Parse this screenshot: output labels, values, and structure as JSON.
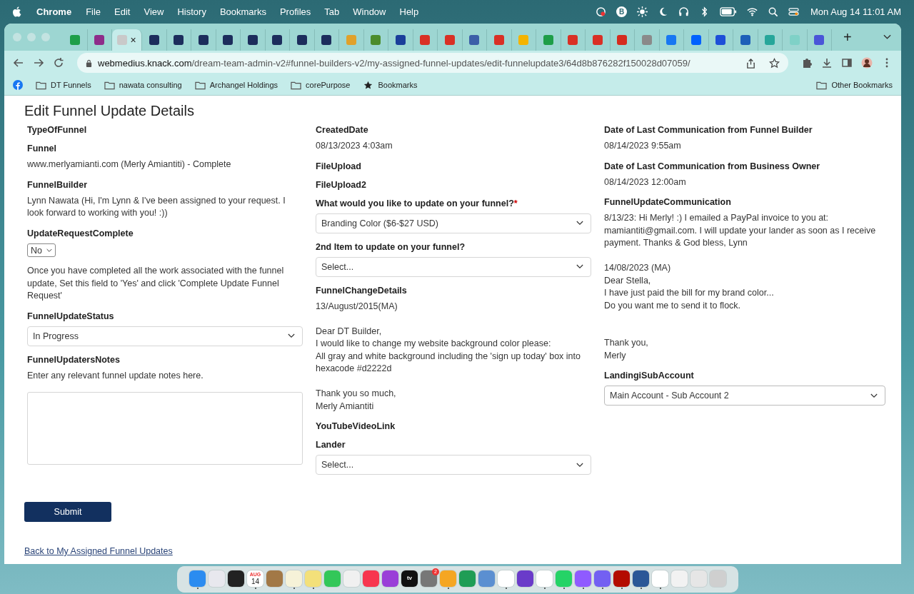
{
  "menu_bar": {
    "app": "Chrome",
    "menus": [
      "File",
      "Edit",
      "View",
      "History",
      "Bookmarks",
      "Profiles",
      "Tab",
      "Window",
      "Help"
    ],
    "status_icons": [
      "B"
    ],
    "clock": "Mon Aug 14  11:01 AM"
  },
  "tabs": [
    {
      "color": "#1e9e48",
      "selected": false
    },
    {
      "color": "#8e2c8a",
      "selected": false
    },
    {
      "color": "#c9c9c9",
      "selected": true,
      "close": "×"
    },
    {
      "color": "#1c2d5c",
      "selected": false
    },
    {
      "color": "#1c2d5c",
      "selected": false
    },
    {
      "color": "#1c2d5c",
      "selected": false
    },
    {
      "color": "#1c2d5c",
      "selected": false
    },
    {
      "color": "#1c2d5c",
      "selected": false
    },
    {
      "color": "#1c2d5c",
      "selected": false
    },
    {
      "color": "#1c2d5c",
      "selected": false
    },
    {
      "color": "#1c2d5c",
      "selected": false
    },
    {
      "color": "#e0a12b",
      "selected": false
    },
    {
      "color": "#4c8c2c",
      "selected": false
    },
    {
      "color": "#1a3e9a",
      "selected": false
    },
    {
      "color": "#d93025",
      "selected": false
    },
    {
      "color": "#d93025",
      "selected": false
    },
    {
      "color": "#3c5fa8",
      "selected": false
    },
    {
      "color": "#d93025",
      "selected": false
    },
    {
      "color": "#f4b400",
      "selected": false
    },
    {
      "color": "#1e9e48",
      "selected": false
    },
    {
      "color": "#d93025",
      "selected": false
    },
    {
      "color": "#d93025",
      "selected": false
    },
    {
      "color": "#d52b1e",
      "selected": false
    },
    {
      "color": "#8a8a8a",
      "selected": false
    },
    {
      "color": "#1877f2",
      "selected": false
    },
    {
      "color": "#0061fe",
      "selected": false
    },
    {
      "color": "#1d4fd8",
      "selected": false
    },
    {
      "color": "#1d5fb8",
      "selected": false
    },
    {
      "color": "#26a69a",
      "selected": false
    },
    {
      "color": "#7fd1c7",
      "selected": false
    },
    {
      "color": "#4a55d8",
      "selected": false
    }
  ],
  "new_tab": "+",
  "address": {
    "domain": "webmedius.knack.com",
    "path": "/dream-team-admin-v2#funnel-builders-v2/my-assigned-funnel-updates/edit-funnelupdate3/64d8b876282f150028d07059/"
  },
  "bookmarks": [
    {
      "kind": "facebook"
    },
    {
      "kind": "folder",
      "label": "DT Funnels"
    },
    {
      "kind": "folder",
      "label": "nawata consulting"
    },
    {
      "kind": "folder",
      "label": "Archangel Holdings"
    },
    {
      "kind": "folder",
      "label": "corePurpose"
    },
    {
      "kind": "star",
      "label": "Bookmarks"
    }
  ],
  "other_bookmarks": "Other Bookmarks",
  "page": {
    "title": "Edit Funnel Update Details",
    "columns": [
      [
        {
          "label": "TypeOfFunnel",
          "kind": "empty"
        },
        {
          "label": "Funnel",
          "kind": "text",
          "text": "www.merlyamianti.com (Merly Amiantiti) - Complete"
        },
        {
          "label": "FunnelBuilder",
          "kind": "text",
          "text": "Lynn Nawata (Hi, I'm Lynn & I've been assigned to your request. I look forward to working with you! :))"
        },
        {
          "label": "UpdateRequestComplete",
          "kind": "mini-select",
          "value": "No",
          "note": "Once you have completed all the work associated with the funnel update, Set this field to 'Yes' and click 'Complete Update Funnel Request'"
        },
        {
          "label": "FunnelUpdateStatus",
          "kind": "select",
          "value": "In Progress"
        },
        {
          "label": "FunnelUpdatersNotes",
          "kind": "textarea",
          "hint": "Enter any relevant funnel update notes here."
        }
      ],
      [
        {
          "label": "CreatedDate",
          "kind": "text",
          "text": "08/13/2023 4:03am"
        },
        {
          "label": "FileUpload",
          "kind": "empty"
        },
        {
          "label": "FileUpload2",
          "kind": "empty"
        },
        {
          "label": "What would you like to update on your funnel?",
          "required": "*",
          "kind": "select",
          "value": "Branding Color ($6-$27 USD)"
        },
        {
          "label": "2nd Item to update on your funnel?",
          "kind": "select",
          "value": "Select..."
        },
        {
          "label": "FunnelChangeDetails",
          "kind": "text",
          "text": "13/August/2015(MA)\n\nDear DT Builder,\nI would like to change my website background color please:\nAll gray and white background including the 'sign up today' box into hexacode #d2222d\n\nThank you so much,\nMerly Amiantiti"
        },
        {
          "label": "YouTubeVideoLink",
          "kind": "empty"
        },
        {
          "label": "Lander",
          "kind": "select",
          "value": "Select..."
        }
      ],
      [
        {
          "label": "Date of Last Communication from Funnel Builder",
          "kind": "text",
          "text": "08/14/2023 9:55am"
        },
        {
          "label": "Date of Last Communication from Business Owner",
          "kind": "text",
          "text": "08/14/2023 12:00am"
        },
        {
          "label": "FunnelUpdateCommunication",
          "kind": "text",
          "text": "8/13/23: Hi Merly! :) I emailed a PayPal invoice to you at: mamiantiti@gmail.com. I will update your lander as soon as I receive payment. Thanks & God bless, Lynn\n\n14/08/2023 (MA)\nDear Stella,\nI have just paid the bill for my brand color...\nDo you want me to send it to flock.\n\n\nThank you,\nMerly"
        },
        {
          "label": "LandingiSubAccount",
          "kind": "select",
          "value": "Main Account - Sub Account 2"
        }
      ]
    ],
    "submit": "Submit",
    "back_link": "Back to My Assigned Funnel Updates"
  },
  "dock": [
    {
      "color": "#2b8cf0",
      "running": true
    },
    {
      "color": "#e8e8ee",
      "running": false
    },
    {
      "color": "#222222",
      "running": false
    },
    {
      "color": "#ffffff",
      "running": true,
      "label": "AUG",
      "sublabel": "14"
    },
    {
      "color": "#a27846",
      "running": false
    },
    {
      "color": "#f6f2d8",
      "running": true
    },
    {
      "color": "#f3e07a",
      "running": true
    },
    {
      "color": "#33c759",
      "running": false
    },
    {
      "color": "#f0f0f0",
      "running": false
    },
    {
      "color": "#f7364f",
      "running": false
    },
    {
      "color": "#9a3fd8",
      "running": false
    },
    {
      "color": "#111111",
      "running": false,
      "label": "tv"
    },
    {
      "color": "#777777",
      "running": false,
      "badge": "2"
    },
    {
      "color": "#f5a623",
      "running": true
    },
    {
      "color": "#1f9d55",
      "running": false
    },
    {
      "color": "#5b8fd1",
      "running": false
    },
    {
      "color": "#ffffff",
      "running": true
    },
    {
      "color": "#6a3bc9",
      "running": false
    },
    {
      "color": "#ffffff",
      "running": true
    },
    {
      "color": "#25d366",
      "running": true
    },
    {
      "color": "#8f5bff",
      "running": true
    },
    {
      "color": "#7360f2",
      "running": true
    },
    {
      "color": "#b30b00",
      "running": true
    },
    {
      "color": "#2b5797",
      "running": true
    },
    {
      "color": "#ffffff",
      "running": true
    },
    {
      "color": "#f2f2f2",
      "running": false
    },
    {
      "color": "#e6e6e6",
      "running": false
    },
    {
      "color": "#cfcfcf",
      "running": false
    }
  ]
}
